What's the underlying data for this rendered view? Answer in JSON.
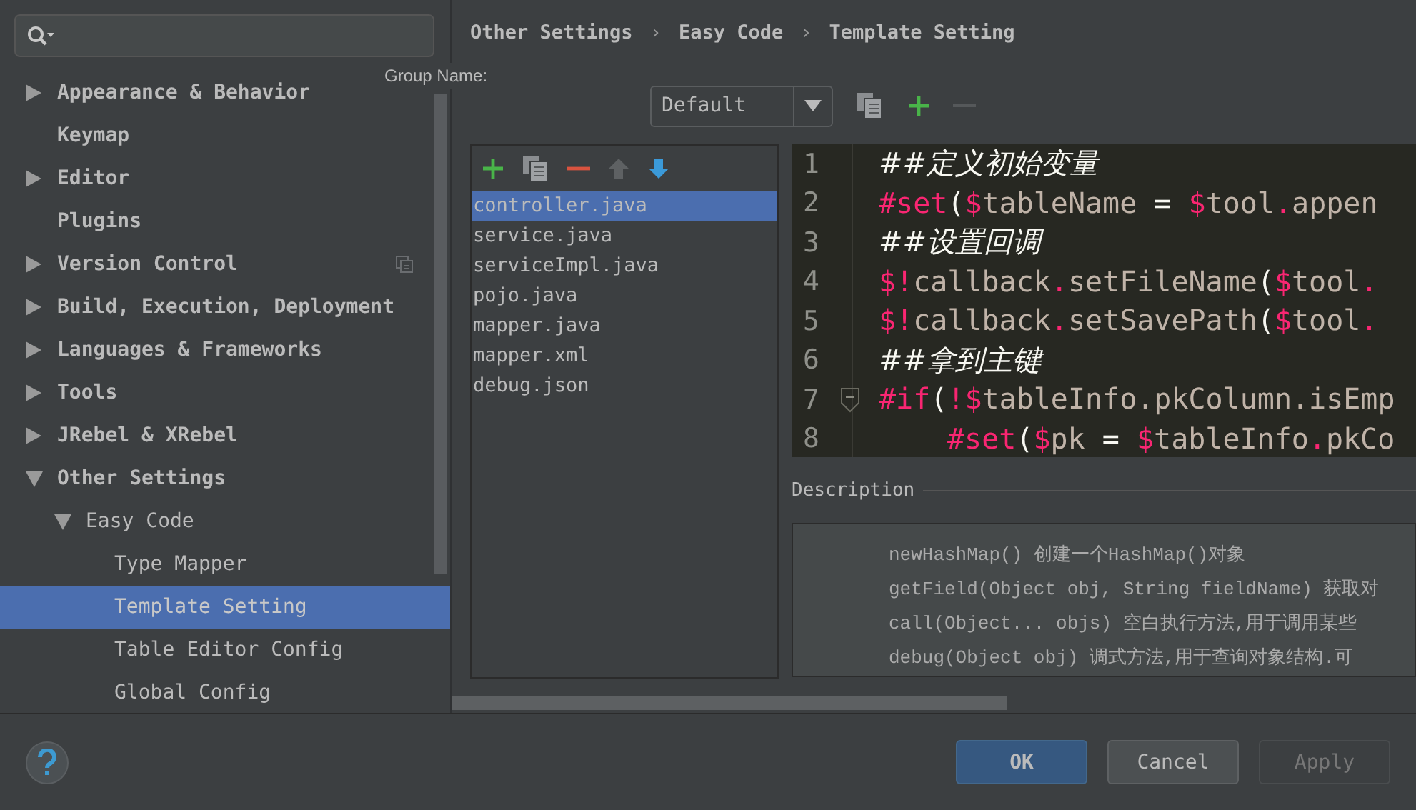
{
  "tree": [
    {
      "label": "Appearance & Behavior",
      "kind": "group",
      "expanded": false,
      "selected": false
    },
    {
      "label": "Keymap",
      "kind": "page",
      "selected": false
    },
    {
      "label": "Editor",
      "kind": "group",
      "expanded": false,
      "selected": false
    },
    {
      "label": "Plugins",
      "kind": "page",
      "selected": false
    },
    {
      "label": "Version Control",
      "kind": "group",
      "expanded": false,
      "selected": false,
      "project_level": true
    },
    {
      "label": "Build, Execution, Deployment",
      "kind": "group",
      "expanded": false,
      "selected": false
    },
    {
      "label": "Languages & Frameworks",
      "kind": "group",
      "expanded": false,
      "selected": false
    },
    {
      "label": "Tools",
      "kind": "group",
      "expanded": false,
      "selected": false
    },
    {
      "label": "JRebel & XRebel",
      "kind": "group",
      "expanded": false,
      "selected": false
    },
    {
      "label": "Other Settings",
      "kind": "group",
      "expanded": true,
      "selected": false,
      "children": [
        {
          "label": "Easy Code",
          "kind": "group",
          "expanded": true,
          "selected": false,
          "children": [
            {
              "label": "Type Mapper",
              "kind": "page",
              "selected": false
            },
            {
              "label": "Template Setting",
              "kind": "page",
              "selected": true
            },
            {
              "label": "Table Editor Config",
              "kind": "page",
              "selected": false
            },
            {
              "label": "Global Config",
              "kind": "page",
              "selected": false
            }
          ]
        }
      ]
    }
  ],
  "breadcrumb": [
    "Other Settings",
    "Easy Code",
    "Template Setting"
  ],
  "breadcrumb_separator": "›",
  "group_name_label": "Group Name:",
  "group_select": {
    "value": "Default"
  },
  "files": [
    {
      "name": "controller.java",
      "selected": true
    },
    {
      "name": "service.java",
      "selected": false
    },
    {
      "name": "serviceImpl.java",
      "selected": false
    },
    {
      "name": "pojo.java",
      "selected": false
    },
    {
      "name": "mapper.java",
      "selected": false
    },
    {
      "name": "mapper.xml",
      "selected": false
    },
    {
      "name": "debug.json",
      "selected": false
    }
  ],
  "code_lines": [
    {
      "number": "1",
      "tokens": [
        {
          "t": "##定义初始变量",
          "kind": "comment"
        }
      ]
    },
    {
      "number": "2",
      "tokens": [
        {
          "t": "#set",
          "kind": "key"
        },
        {
          "t": "(",
          "kind": "op"
        },
        {
          "t": "$",
          "kind": "key"
        },
        {
          "t": "tableName",
          "kind": "plain"
        },
        {
          "t": " = ",
          "kind": "op"
        },
        {
          "t": "$",
          "kind": "key"
        },
        {
          "t": "tool",
          "kind": "plain"
        },
        {
          "t": ".",
          "kind": "key"
        },
        {
          "t": "appen",
          "kind": "plain"
        }
      ]
    },
    {
      "number": "3",
      "tokens": [
        {
          "t": "##设置回调",
          "kind": "comment"
        }
      ]
    },
    {
      "number": "4",
      "tokens": [
        {
          "t": "$!",
          "kind": "key"
        },
        {
          "t": "callback",
          "kind": "plain"
        },
        {
          "t": ".",
          "kind": "key"
        },
        {
          "t": "setFileName",
          "kind": "plain"
        },
        {
          "t": "(",
          "kind": "op"
        },
        {
          "t": "$",
          "kind": "key"
        },
        {
          "t": "tool",
          "kind": "plain"
        },
        {
          "t": ".",
          "kind": "key"
        }
      ]
    },
    {
      "number": "5",
      "tokens": [
        {
          "t": "$!",
          "kind": "key"
        },
        {
          "t": "callback",
          "kind": "plain"
        },
        {
          "t": ".",
          "kind": "key"
        },
        {
          "t": "setSavePath",
          "kind": "plain"
        },
        {
          "t": "(",
          "kind": "op"
        },
        {
          "t": "$",
          "kind": "key"
        },
        {
          "t": "tool",
          "kind": "plain"
        },
        {
          "t": ".",
          "kind": "key"
        }
      ]
    },
    {
      "number": "6",
      "tokens": [
        {
          "t": "##拿到主键",
          "kind": "comment"
        }
      ]
    },
    {
      "number": "7",
      "fold": true,
      "tokens": [
        {
          "t": "#if",
          "kind": "key"
        },
        {
          "t": "(",
          "kind": "op"
        },
        {
          "t": "!$",
          "kind": "key"
        },
        {
          "t": "tableInfo.pkColumn.isEmp",
          "kind": "plain"
        }
      ]
    },
    {
      "number": "8",
      "indent": true,
      "tokens": [
        {
          "t": "#set",
          "kind": "key"
        },
        {
          "t": "(",
          "kind": "op"
        },
        {
          "t": "$",
          "kind": "key"
        },
        {
          "t": "pk",
          "kind": "plain"
        },
        {
          "t": " = ",
          "kind": "op"
        },
        {
          "t": "$",
          "kind": "key"
        },
        {
          "t": "tableInfo",
          "kind": "plain"
        },
        {
          "t": ".",
          "kind": "key"
        },
        {
          "t": "pkCo",
          "kind": "plain"
        }
      ]
    }
  ],
  "description_label": "Description",
  "description_lines": [
    "newHashMap() 创建一个HashMap()对象",
    "getField(Object obj, String fieldName) 获取对",
    "call(Object... objs) 空白执行方法,用于调用某些",
    "debug(Object obj) 调式方法,用于查询对象结构.可"
  ],
  "buttons": [
    {
      "label": "OK",
      "kind": "default",
      "disabled": false
    },
    {
      "label": "Cancel",
      "kind": "normal",
      "disabled": false
    },
    {
      "label": "Apply",
      "kind": "normal",
      "disabled": true
    }
  ]
}
